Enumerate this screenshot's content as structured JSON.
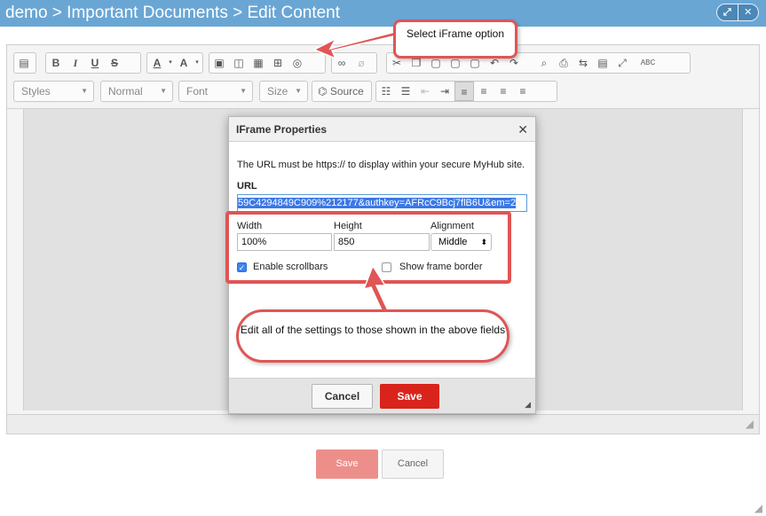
{
  "breadcrumb": "demo > Important Documents > Edit Content",
  "window_buttons": {
    "expand": "⤢",
    "close": "✕"
  },
  "toolbar": {
    "styles_combo": "Styles",
    "format_combo": "Normal",
    "font_combo": "Font",
    "size_combo": "Size",
    "source_label": "Source",
    "bold": "B",
    "italic": "I",
    "underline": "U",
    "strike": "S",
    "text_color": "A",
    "bg_color": "A",
    "spellcheck": "ABC"
  },
  "dialog": {
    "title": "IFrame Properties",
    "close": "✕",
    "info": "The URL must be https:// to display within your secure MyHub site.",
    "url_label": "URL",
    "url_value": "59C4294849C909%212177&authkey=AFRcC9Bcj7flB6U&em=2",
    "width_label": "Width",
    "width_value": "100%",
    "height_label": "Height",
    "height_value": "850",
    "alignment_label": "Alignment",
    "alignment_value": "Middle",
    "scrollbars_label": "Enable scrollbars",
    "scrollbars_checked": true,
    "border_label": "Show frame border",
    "border_checked": false,
    "cancel": "Cancel",
    "save": "Save"
  },
  "annotations": {
    "callout_top": "Select iFrame option",
    "callout_bottom": "Edit all of the settings to those shown in the above fields"
  },
  "page_buttons": {
    "save": "Save",
    "cancel": "Cancel"
  },
  "colors": {
    "accent": "#6aa6d4",
    "highlight": "#e05555",
    "save": "#d9241b"
  }
}
